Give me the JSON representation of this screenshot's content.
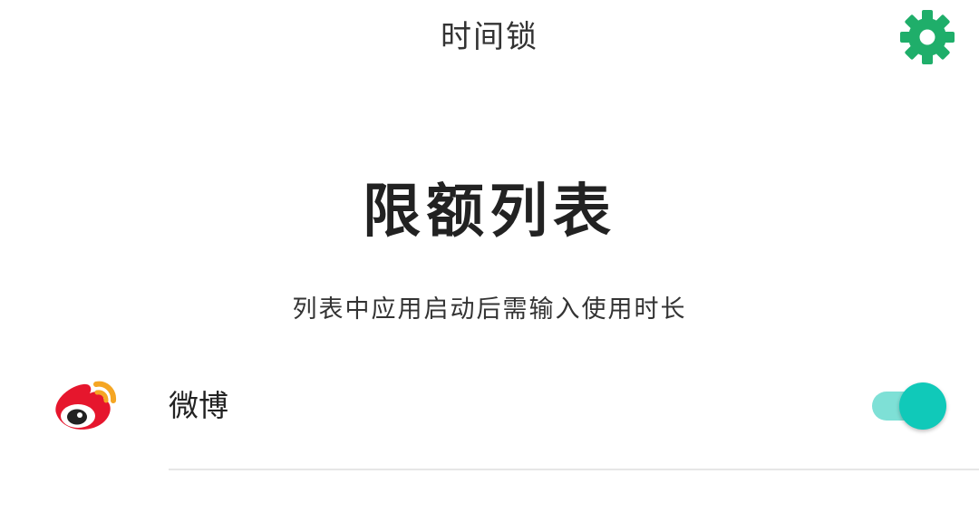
{
  "header": {
    "title": "时间锁",
    "settings_icon": "gear-icon",
    "settings_color": "#1fae6a"
  },
  "main": {
    "heading": "限额列表",
    "description": "列表中应用启动后需输入使用时长"
  },
  "app_list": [
    {
      "name": "微博",
      "icon": "weibo-icon",
      "enabled": true,
      "toggle_color": "#10c9b9"
    }
  ]
}
